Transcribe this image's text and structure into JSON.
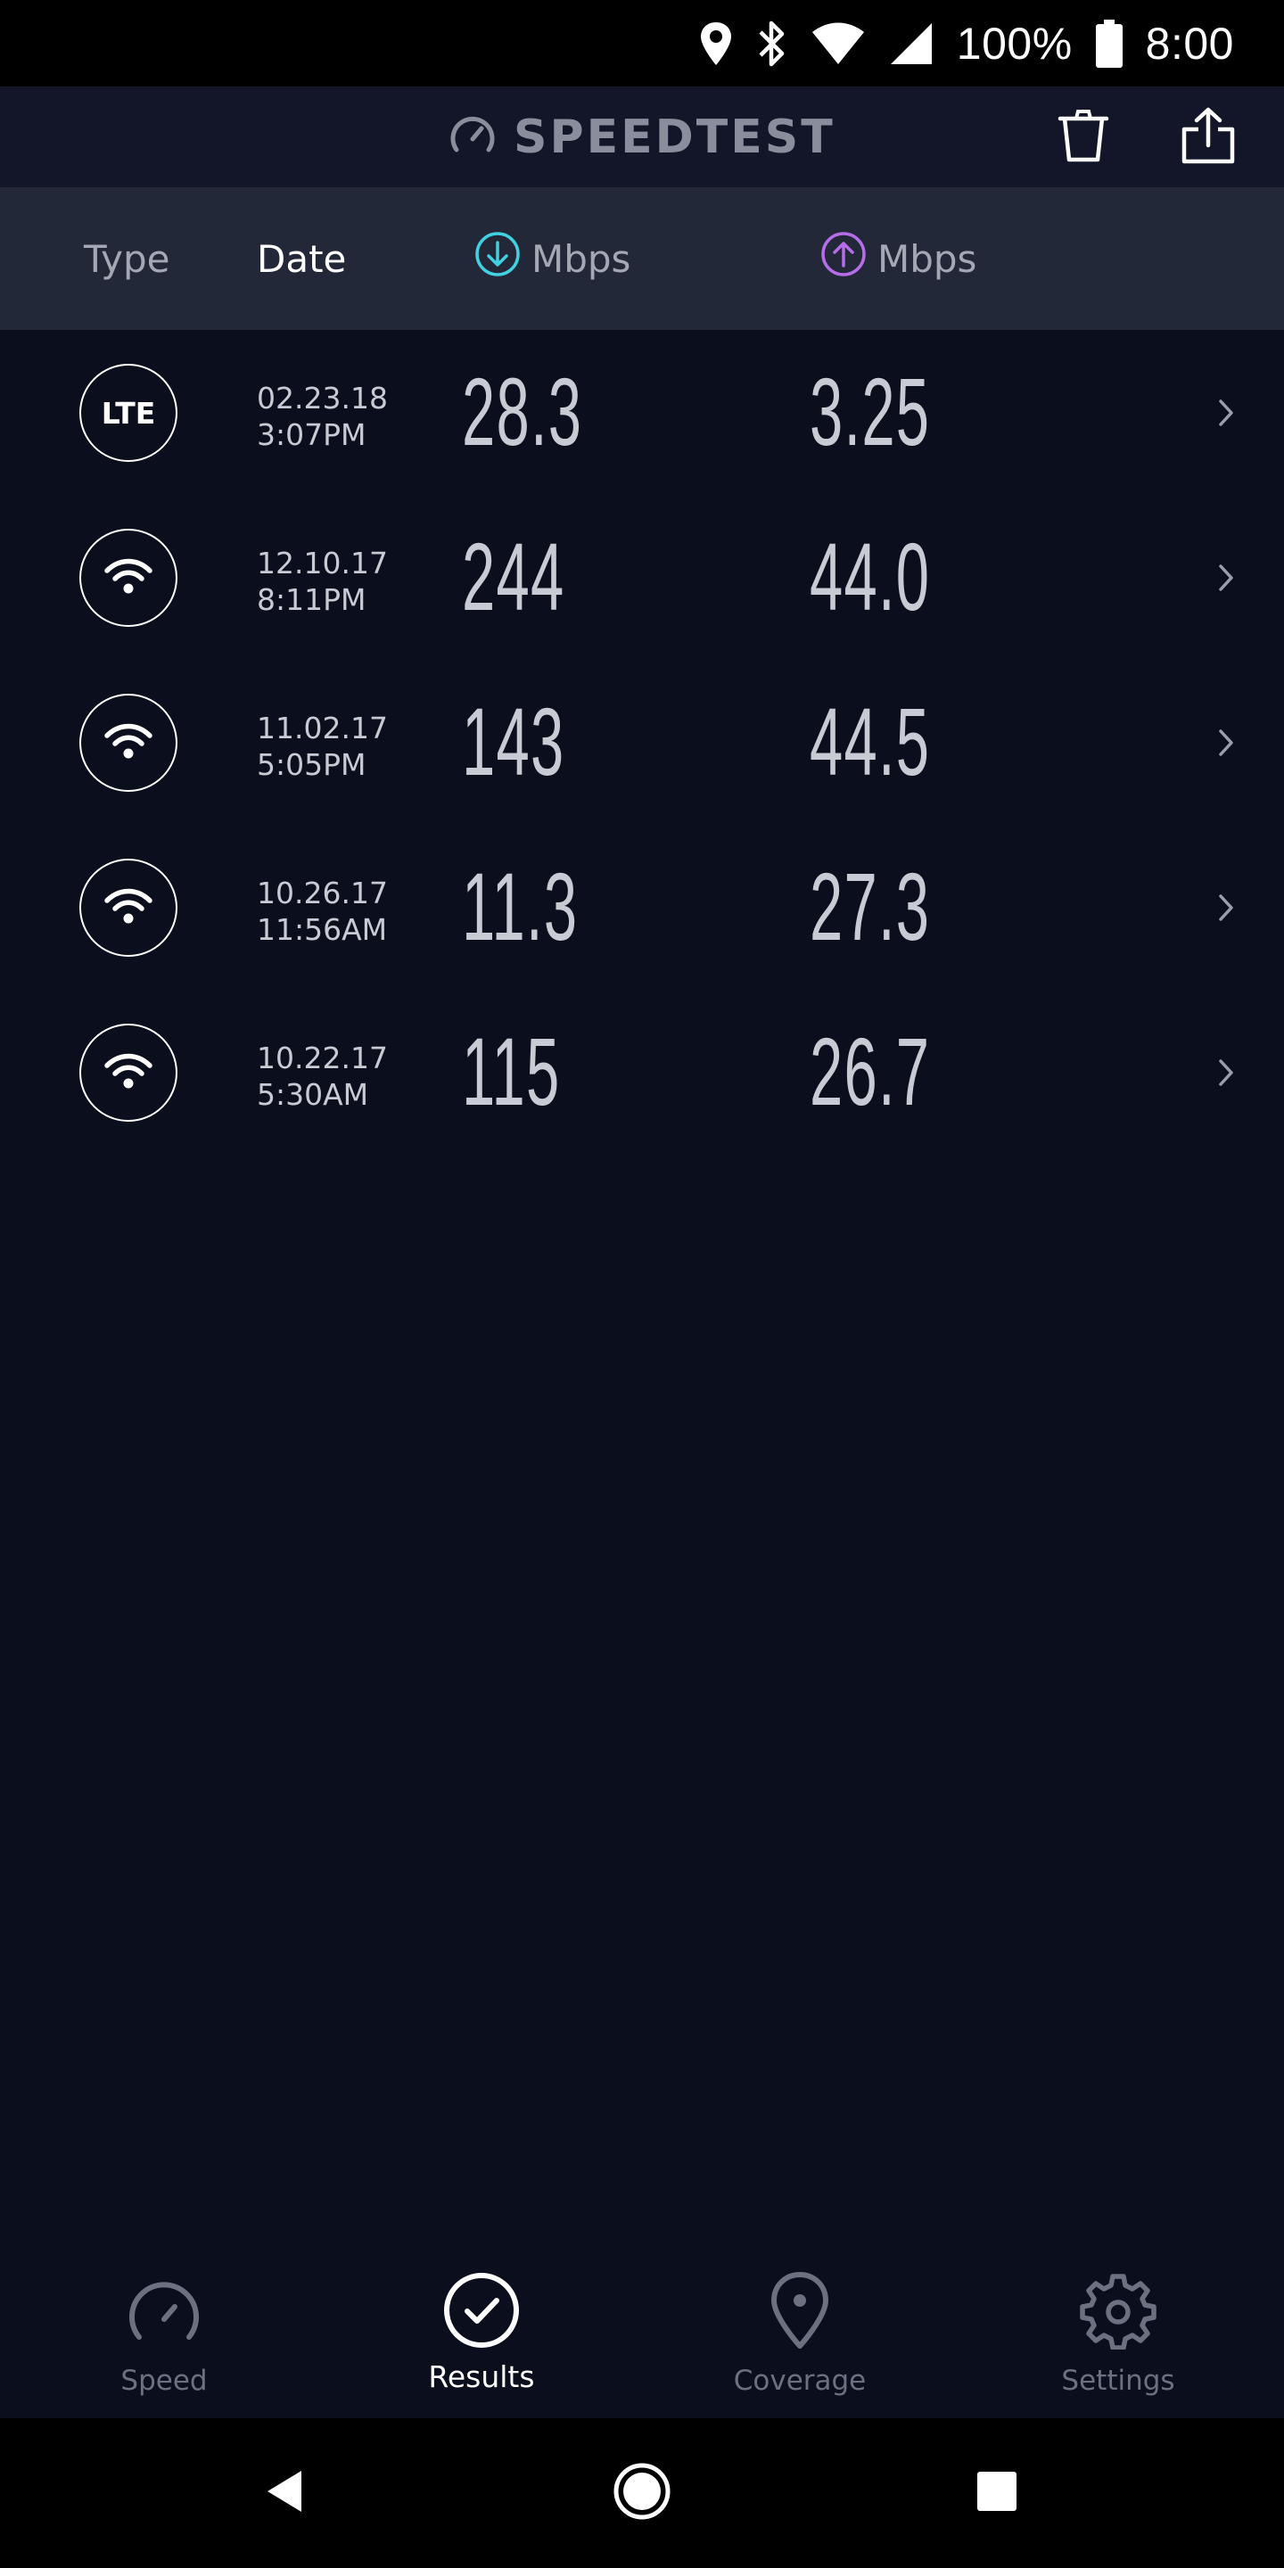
{
  "status_bar": {
    "battery_percent": "100%",
    "time": "8:00",
    "icons": [
      "location-icon",
      "bluetooth-icon",
      "wifi-signal-icon",
      "cell-signal-icon",
      "battery-icon"
    ]
  },
  "header": {
    "brand": "SPEEDTEST",
    "logo_icon": "speedometer-icon",
    "actions": [
      "trash-icon",
      "share-icon"
    ]
  },
  "columns": {
    "type": "Type",
    "date": "Date",
    "download_unit": "Mbps",
    "upload_unit": "Mbps",
    "download_icon": "download-arrow-icon",
    "upload_icon": "upload-arrow-icon",
    "download_color": "#41d1e0",
    "upload_color": "#b56ee8"
  },
  "results": [
    {
      "type": "LTE",
      "date": "02.23.18",
      "time": "3:07PM",
      "download": "28.3",
      "upload": "3.25"
    },
    {
      "type": "wifi",
      "date": "12.10.17",
      "time": "8:11PM",
      "download": "244",
      "upload": "44.0"
    },
    {
      "type": "wifi",
      "date": "11.02.17",
      "time": "5:05PM",
      "download": "143",
      "upload": "44.5"
    },
    {
      "type": "wifi",
      "date": "10.26.17",
      "time": "11:56AM",
      "download": "11.3",
      "upload": "27.3"
    },
    {
      "type": "wifi",
      "date": "10.22.17",
      "time": "5:30AM",
      "download": "115",
      "upload": "26.7"
    }
  ],
  "nav": {
    "items": [
      {
        "label": "Speed",
        "icon": "speed-gauge-icon",
        "active": false
      },
      {
        "label": "Results",
        "icon": "check-circle-icon",
        "active": true
      },
      {
        "label": "Coverage",
        "icon": "map-pin-icon",
        "active": false
      },
      {
        "label": "Settings",
        "icon": "gear-icon",
        "active": false
      }
    ]
  },
  "system_nav": [
    "back-icon",
    "home-icon",
    "recents-icon"
  ]
}
